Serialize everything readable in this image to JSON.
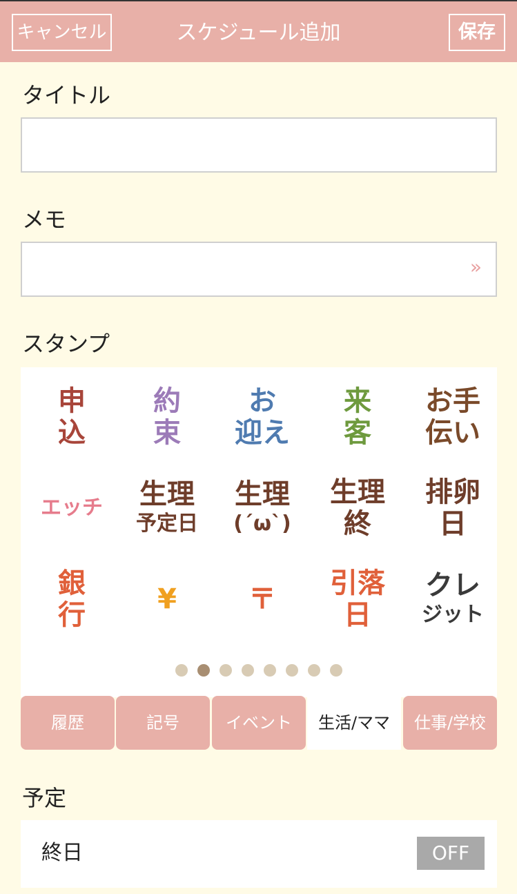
{
  "header": {
    "cancel_label": "キャンセル",
    "title": "スケジュール追加",
    "save_label": "保存"
  },
  "form": {
    "title_label": "タイトル",
    "title_value": "",
    "memo_label": "メモ",
    "memo_value": "",
    "memo_arrow": "»",
    "stamp_label": "スタンプ",
    "schedule_label": "予定"
  },
  "stamps": [
    {
      "lines": [
        "申",
        "込"
      ],
      "color": "#a8453a"
    },
    {
      "lines": [
        "約",
        "束"
      ],
      "color": "#9c7bb8"
    },
    {
      "lines": [
        "お",
        "迎え"
      ],
      "color": "#4f7bb0"
    },
    {
      "lines": [
        "来",
        "客"
      ],
      "color": "#6e9a3e"
    },
    {
      "lines": [
        "お手",
        "伝い"
      ],
      "color": "#7a4a2a"
    },
    {
      "lines": [
        "エッチ"
      ],
      "color": "#e67c8c"
    },
    {
      "lines": [
        "生理",
        "予定日"
      ],
      "color": "#6e3d2a"
    },
    {
      "lines": [
        "生理",
        "(´ω`)"
      ],
      "color": "#6e3d2a"
    },
    {
      "lines": [
        "生理",
        "終"
      ],
      "color": "#6e3d2a"
    },
    {
      "lines": [
        "排卵",
        "日"
      ],
      "color": "#6e3d2a"
    },
    {
      "lines": [
        "銀",
        "行"
      ],
      "color": "#e0603a"
    },
    {
      "lines": [
        "¥"
      ],
      "color": "#f0a020"
    },
    {
      "lines": [
        "〒"
      ],
      "color": "#e0603a"
    },
    {
      "lines": [
        "引落",
        "日"
      ],
      "color": "#e0603a"
    },
    {
      "lines": [
        "クレ",
        "ジット"
      ],
      "color": "#3a3a3a"
    }
  ],
  "pager": {
    "count": 8,
    "active": 1
  },
  "tabs": [
    {
      "label": "履歴"
    },
    {
      "label": "記号"
    },
    {
      "label": "イベント"
    },
    {
      "label": "生活/ママ"
    },
    {
      "label": "仕事/学校"
    }
  ],
  "selected_tab": 3,
  "allday": {
    "label": "終日",
    "toggle": "OFF"
  },
  "colors": {
    "header_bg": "#e8b0a8",
    "page_bg": "#fffbe6",
    "tab_bg": "#e8b0a8",
    "toggle_off": "#a9a9a9"
  }
}
